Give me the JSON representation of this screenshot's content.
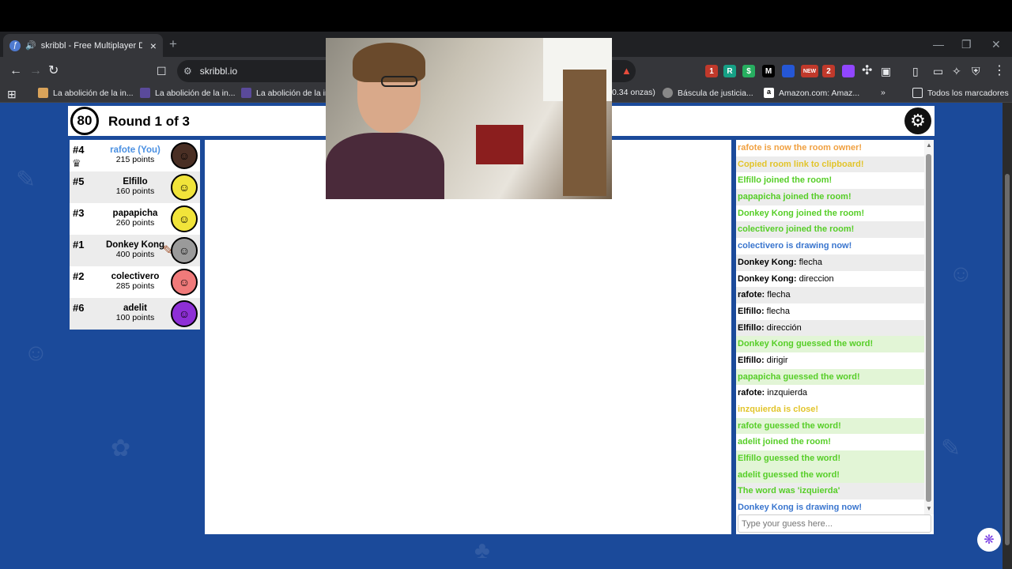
{
  "browser": {
    "tab": {
      "title": "skribbl - Free Multiplayer Dra",
      "favicon": "quill-icon"
    },
    "new_tab_symbol": "+",
    "url": "skribbl.io",
    "extensions": [
      {
        "name": "extension-1-icon",
        "color": "#c0392b",
        "text": "1"
      },
      {
        "name": "extension-r-icon",
        "color": "#16a085",
        "text": "R"
      },
      {
        "name": "extension-dollar-icon",
        "color": "#27ae60",
        "text": "$"
      },
      {
        "name": "extension-shield-icon",
        "color": "#2557d6",
        "text": ""
      },
      {
        "name": "extension-m-icon",
        "color": "#000000",
        "text": "M"
      },
      {
        "name": "extension-new-icon",
        "color": "#c0392b",
        "text": "NEW"
      },
      {
        "name": "extension-2-icon",
        "color": "#c0392b",
        "text": "2"
      },
      {
        "name": "extension-twitch-icon",
        "color": "#9146ff",
        "text": ""
      }
    ],
    "bookmarks": [
      "La abolición de la in...",
      "La abolición de la in...",
      "La abolición de la in",
      "0.34 onzas)",
      "Báscula de justicia...",
      "Amazon.com: Amaz..."
    ],
    "all_bookmarks": "Todos los marcadores"
  },
  "game": {
    "timer": "80",
    "round": "Round 1 of 3",
    "players": [
      {
        "rank": "#4",
        "name": "rafote (You)",
        "points": "215 points",
        "you": true,
        "owner": true,
        "avatar_color": "#4a2f24",
        "drawing": false
      },
      {
        "rank": "#5",
        "name": "Elfillo",
        "points": "160 points",
        "you": false,
        "owner": false,
        "avatar_color": "#f1e43a",
        "drawing": false
      },
      {
        "rank": "#3",
        "name": "papapicha",
        "points": "260 points",
        "you": false,
        "owner": false,
        "avatar_color": "#f1e43a",
        "drawing": false
      },
      {
        "rank": "#1",
        "name": "Donkey Kong",
        "points": "400 points",
        "you": false,
        "owner": false,
        "avatar_color": "#9a9a9a",
        "drawing": true
      },
      {
        "rank": "#2",
        "name": "colectivero",
        "points": "285 points",
        "you": false,
        "owner": false,
        "avatar_color": "#f07a7a",
        "drawing": false
      },
      {
        "rank": "#6",
        "name": "adelit",
        "points": "100 points",
        "you": false,
        "owner": false,
        "avatar_color": "#8e2fd6",
        "drawing": false
      }
    ],
    "chat": [
      {
        "type": "system",
        "text": "rafote is now the room owner!",
        "color": "#f0a040",
        "bg": ""
      },
      {
        "type": "system",
        "text": "Copied room link to clipboard!",
        "color": "#e2c42a",
        "bg": "alt"
      },
      {
        "type": "system",
        "text": "Elfillo joined the room!",
        "color": "#56ce27",
        "bg": ""
      },
      {
        "type": "system",
        "text": "papapicha joined the room!",
        "color": "#56ce27",
        "bg": "alt"
      },
      {
        "type": "system",
        "text": "Donkey Kong joined the room!",
        "color": "#56ce27",
        "bg": ""
      },
      {
        "type": "system",
        "text": "colectivero joined the room!",
        "color": "#56ce27",
        "bg": "alt"
      },
      {
        "type": "system",
        "text": "colectivero is drawing now!",
        "color": "#3975ce",
        "bg": ""
      },
      {
        "type": "user",
        "who": "Donkey Kong:",
        "text": "flecha",
        "bg": "alt"
      },
      {
        "type": "user",
        "who": "Donkey Kong:",
        "text": "direccion",
        "bg": ""
      },
      {
        "type": "user",
        "who": "rafote:",
        "text": "flecha",
        "bg": "alt"
      },
      {
        "type": "user",
        "who": "Elfillo:",
        "text": "flecha",
        "bg": ""
      },
      {
        "type": "user",
        "who": "Elfillo:",
        "text": "dirección",
        "bg": "alt"
      },
      {
        "type": "system",
        "text": "Donkey Kong guessed the word!",
        "color": "#56ce27",
        "bg": "alt-green"
      },
      {
        "type": "user",
        "who": "Elfillo:",
        "text": "dirigir",
        "bg": ""
      },
      {
        "type": "system",
        "text": "papapicha guessed the word!",
        "color": "#56ce27",
        "bg": "alt-green"
      },
      {
        "type": "user",
        "who": "rafote:",
        "text": "inzquierda",
        "bg": ""
      },
      {
        "type": "system",
        "text": "inzquierda is close!",
        "color": "#e2c42a",
        "bg": ""
      },
      {
        "type": "system",
        "text": "rafote guessed the word!",
        "color": "#56ce27",
        "bg": "alt-green"
      },
      {
        "type": "system",
        "text": "adelit joined the room!",
        "color": "#56ce27",
        "bg": ""
      },
      {
        "type": "system",
        "text": "Elfillo guessed the word!",
        "color": "#56ce27",
        "bg": "alt-green"
      },
      {
        "type": "system",
        "text": "adelit guessed the word!",
        "color": "#56ce27",
        "bg": "alt-green"
      },
      {
        "type": "system",
        "text": "The word was 'izquierda'",
        "color": "#56ce27",
        "bg": "alt"
      },
      {
        "type": "system",
        "text": "Donkey Kong is drawing now!",
        "color": "#3975ce",
        "bg": ""
      }
    ],
    "guess_placeholder": "Type your guess here..."
  }
}
